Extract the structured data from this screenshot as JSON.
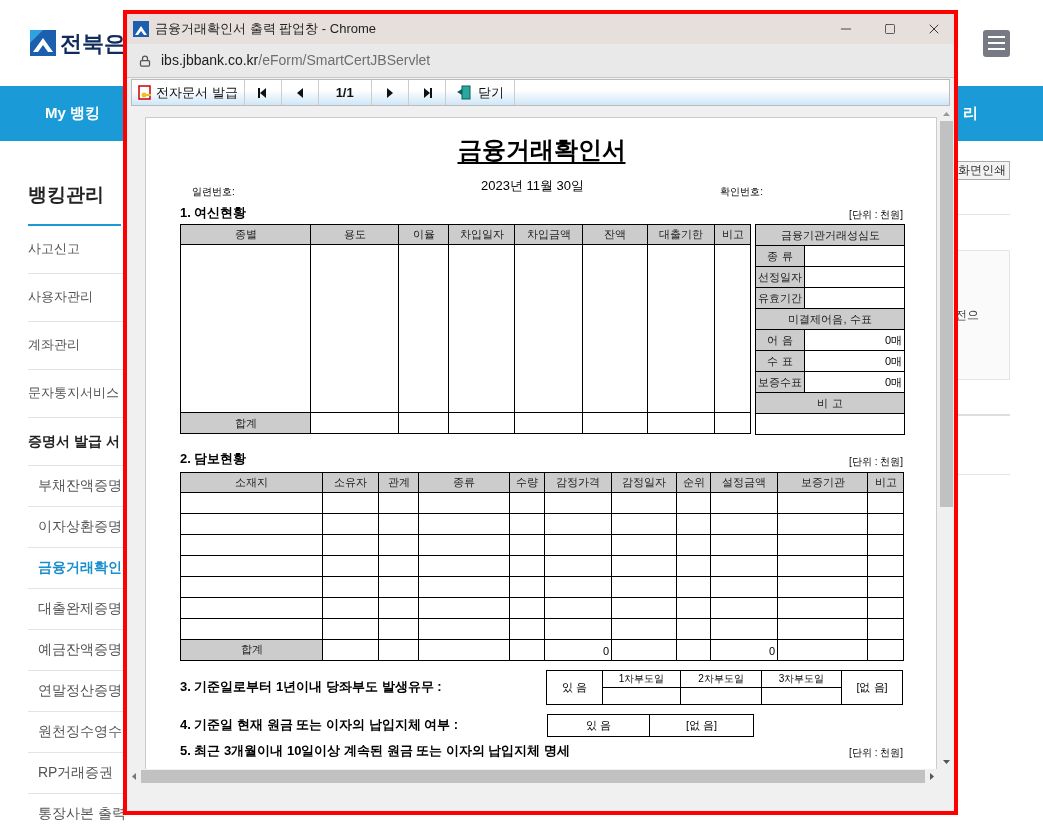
{
  "site": {
    "logo_text": "전북은",
    "nav_left": "My 뱅킹",
    "nav_right": "리",
    "sidebar": {
      "title": "뱅킹관리",
      "items": [
        {
          "label": "사고신고",
          "kind": "item",
          "selected": false
        },
        {
          "label": "사용자관리",
          "kind": "item",
          "selected": false
        },
        {
          "label": "계좌관리",
          "kind": "item",
          "selected": false
        },
        {
          "label": "문자통지서비스",
          "kind": "item",
          "selected": false
        },
        {
          "label": "증명서 발급 서",
          "kind": "group",
          "selected": false
        },
        {
          "label": "부채잔액증명",
          "kind": "sub",
          "selected": false
        },
        {
          "label": "이자상환증명",
          "kind": "sub",
          "selected": false
        },
        {
          "label": "금융거래확인",
          "kind": "sub",
          "selected": true
        },
        {
          "label": "대출완제증명",
          "kind": "sub",
          "selected": false
        },
        {
          "label": "예금잔액증명",
          "kind": "sub",
          "selected": false
        },
        {
          "label": "연말정산증명",
          "kind": "sub",
          "selected": false
        },
        {
          "label": "원천징수영수",
          "kind": "sub",
          "selected": false
        },
        {
          "label": "RP거래증권",
          "kind": "sub",
          "selected": false
        },
        {
          "label": "통장사본 출력",
          "kind": "sub",
          "selected": false
        }
      ]
    },
    "print_button": "화면인쇄",
    "notice_text": "전으"
  },
  "popup": {
    "title": "금융거래확인서 출력 팝업창 - Chrome",
    "url_host": "ibs.jbbank.co.kr",
    "url_path": "/eForm/SmartCertJBServlet",
    "toolbar": {
      "issue": "전자문서 발급",
      "page": "1/1",
      "close": "닫기"
    },
    "document": {
      "title": "금융거래확인서",
      "serial_label": "일련번호:",
      "date": "2023년 11월 30일",
      "confirm_label": "확인번호:",
      "section1": {
        "heading": "1. 여신현황",
        "unit": "[단위 : 천원]",
        "columns": [
          "종별",
          "용도",
          "이율",
          "차입일자",
          "차입금액",
          "잔액",
          "대출기한",
          "비고"
        ],
        "total_label": "합계",
        "side": [
          {
            "kind": "header",
            "label": "금융기관거래성심도"
          },
          {
            "kind": "field",
            "label": "종 류"
          },
          {
            "kind": "field",
            "label": "선정일자"
          },
          {
            "kind": "field",
            "label": "유효기간"
          },
          {
            "kind": "header",
            "label": "미결제어음, 수표"
          },
          {
            "kind": "field",
            "label": "어 음",
            "value": "0매"
          },
          {
            "kind": "field",
            "label": "수 표",
            "value": "0매"
          },
          {
            "kind": "field",
            "label": "보증수표",
            "value": "0매"
          },
          {
            "kind": "header",
            "label": "비 고"
          },
          {
            "kind": "blank"
          }
        ]
      },
      "section2": {
        "heading": "2. 담보현황",
        "unit": "[단위 : 천원]",
        "columns": [
          "소재지",
          "소유자",
          "관계",
          "종류",
          "수량",
          "감정가격",
          "감정일자",
          "순위",
          "설정금액",
          "보증기관",
          "비고"
        ],
        "total_label": "합계",
        "totals": [
          {
            "kind": "blank"
          },
          {
            "kind": "blank"
          },
          {
            "kind": "blank"
          },
          {
            "kind": "blank"
          },
          {
            "kind": "value",
            "value": "0"
          },
          {
            "kind": "blank"
          },
          {
            "kind": "blank"
          },
          {
            "kind": "value",
            "value": "0"
          },
          {
            "kind": "blank"
          },
          {
            "kind": "blank"
          }
        ]
      },
      "section3": {
        "label": "3. 기준일로부터 1년이내 당좌부도 발생유무 :",
        "yes": "있 음",
        "dates": [
          "1차부도일",
          "2차부도일",
          "3차부도일"
        ],
        "no": "[없 음]"
      },
      "section4": {
        "label": "4. 기준일 현재 원금 또는 이자의 납입지체 여부 :",
        "yes": "있 음",
        "no": "[없 음]"
      },
      "section5": {
        "label": "5. 최근 3개월이내 10일이상 계속된 원금 또는 이자의 납입지체 명세",
        "unit": "[단위 : 천원]"
      }
    }
  }
}
